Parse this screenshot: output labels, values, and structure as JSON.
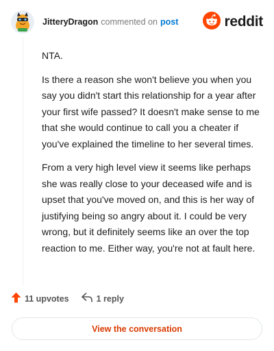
{
  "header": {
    "username": "JitteryDragon",
    "action": "commented on",
    "post_link": "post",
    "brand": "reddit"
  },
  "comment": {
    "paragraphs": [
      "NTA.",
      "Is there a reason she won't believe you when you say you didn't start this relationship for a year after your first wife passed? It doesn't make sense to me that she would continue to call you a cheater if you've explained the timeline to her several times.",
      "From a very high level view it seems like perhaps she was really close to your deceased wife and is upset that you've moved on, and this is her way of justifying being so angry about it. I could be very wrong, but it definitely seems like an over the top reaction to me. Either way, you're not at fault here."
    ]
  },
  "actions": {
    "upvotes": "11 upvotes",
    "replies": "1 reply"
  },
  "cta": {
    "label": "View the conversation"
  },
  "colors": {
    "reddit_orange": "#ff4500",
    "link_blue": "#0079d3",
    "cta_text": "#d93a00"
  },
  "icons": {
    "avatar": "avatar-dragon",
    "brand": "reddit-snoo-icon",
    "upvote": "upvote-arrow-icon",
    "reply": "reply-arrow-icon"
  }
}
